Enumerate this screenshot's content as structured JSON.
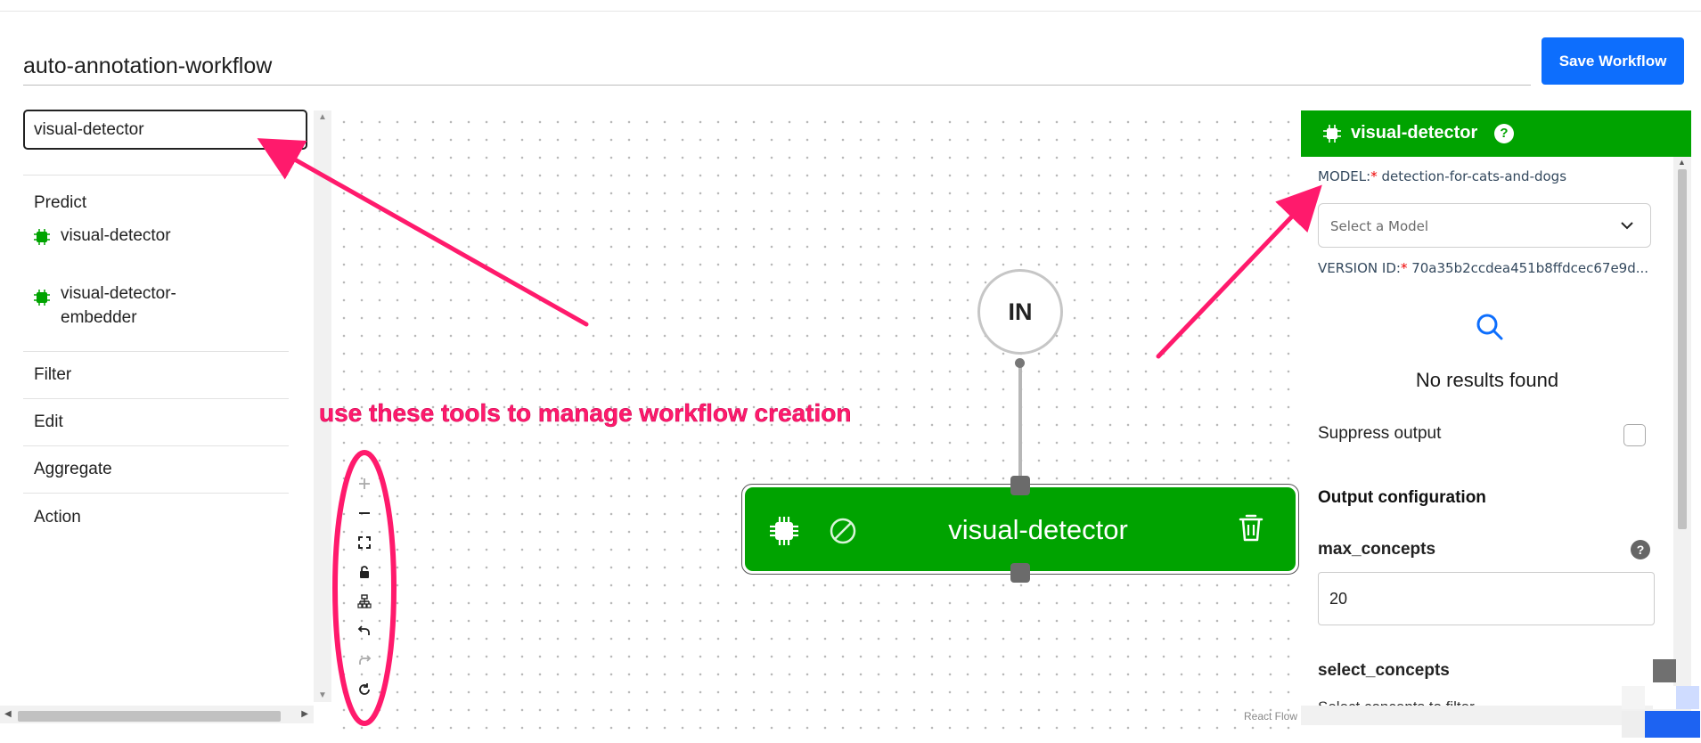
{
  "header": {
    "workflow_name": "auto-annotation-workflow",
    "save_label": "Save Workflow"
  },
  "sidebar": {
    "search_value": "visual-detector",
    "categories": {
      "predict": "Predict",
      "filter": "Filter",
      "edit": "Edit",
      "aggregate": "Aggregate",
      "action": "Action"
    },
    "predict_items": [
      {
        "label": "visual-detector",
        "icon": "chip-icon"
      },
      {
        "label": "visual-detector-embedder",
        "icon": "chip-icon"
      }
    ]
  },
  "canvas": {
    "in_node_label": "IN",
    "node_label": "visual-detector",
    "attribution": "React Flow",
    "controls": [
      "zoom-in",
      "zoom-out",
      "fit-view",
      "lock",
      "auto-layout",
      "undo",
      "redo",
      "reset"
    ]
  },
  "annotation": {
    "text": "use these tools to manage workflow creation",
    "color": "#ff1a6c"
  },
  "panel": {
    "title": "visual-detector",
    "help_glyph": "?",
    "model_label": "MODEL:",
    "model_required": "*",
    "model_value": "detection-for-cats-and-dogs",
    "select_placeholder": "Select a Model",
    "version_label": "VERSION ID:",
    "version_required": "*",
    "version_value": "70a35b2ccdea451b8ffdcec67e9d...",
    "no_results": "No results found",
    "suppress_label": "Suppress output",
    "suppress_checked": false,
    "output_config_heading": "Output configuration",
    "max_concepts_label": "max_concepts",
    "max_concepts_value": "20",
    "select_concepts_label": "select_concepts",
    "select_concepts_sub": "Select concepts to filter"
  },
  "colors": {
    "accent": "#0d6efd",
    "node_green": "#00a300",
    "annotation_pink": "#ff1a6c"
  }
}
